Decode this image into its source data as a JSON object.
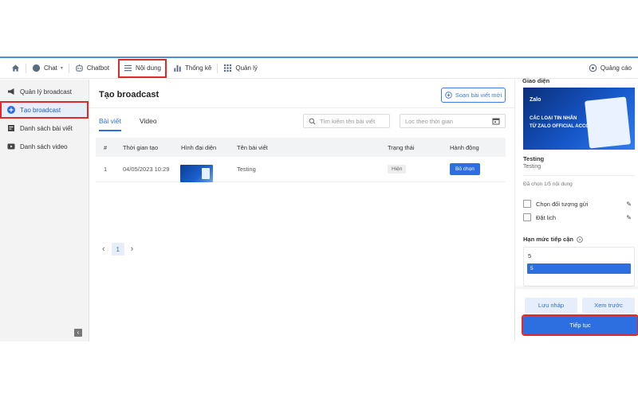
{
  "nav": {
    "chat": "Chat",
    "chatbot": "Chatbot",
    "content": "Nội dung",
    "stats": "Thống kê",
    "manage": "Quản lý",
    "ads": "Quảng cáo"
  },
  "sidebar": {
    "items": [
      {
        "label": "Quản lý broadcast",
        "icon": "megaphone-icon"
      },
      {
        "label": "Tạo broadcast",
        "icon": "plus-circle-icon"
      },
      {
        "label": "Danh sách bài viết",
        "icon": "article-icon"
      },
      {
        "label": "Danh sách video",
        "icon": "video-icon"
      }
    ],
    "collapse": "‹"
  },
  "main": {
    "title": "Tạo broadcast",
    "new_post": "Soạn bài viết mới",
    "tabs": [
      "Bài viết",
      "Video"
    ],
    "search_placeholder": "Tìm kiếm tên bài viết",
    "date_placeholder": "Lọc theo thời gian"
  },
  "table": {
    "headers": [
      "#",
      "Thời gian tạo",
      "Hình đại diện",
      "Tên bài viết",
      "Trạng thái",
      "Hành động"
    ],
    "rows": [
      {
        "index": "1",
        "created": "04/05/2023 10:29",
        "title": "Testing",
        "status": "Hiện",
        "action": "Bỏ chọn"
      }
    ]
  },
  "pager": {
    "current": "1",
    "prev": "‹",
    "next": "›"
  },
  "panel": {
    "heading": "Giao diện",
    "preview": {
      "logo": "Zalo",
      "line1": "CÁC LOẠI TIN NHẮN",
      "line2": "TỪ ZALO OFFICIAL ACCOUNT"
    },
    "post_title": "Testing",
    "post_subtitle": "Testing",
    "chosen_text": "Đã chọn 1/5 nội dung",
    "recipients": "Chọn đối tượng gửi",
    "schedule": "Đặt lịch",
    "limit_title": "Hạn mức tiếp cận",
    "limit_value": "5",
    "limit_bar_value": "5",
    "save_draft": "Lưu nháp",
    "preview_btn": "Xem trước",
    "continue": "Tiếp tục"
  },
  "colors": {
    "accent": "#2d6fe0",
    "highlight": "#e02a2a",
    "top_border": "#4a8fd9"
  }
}
